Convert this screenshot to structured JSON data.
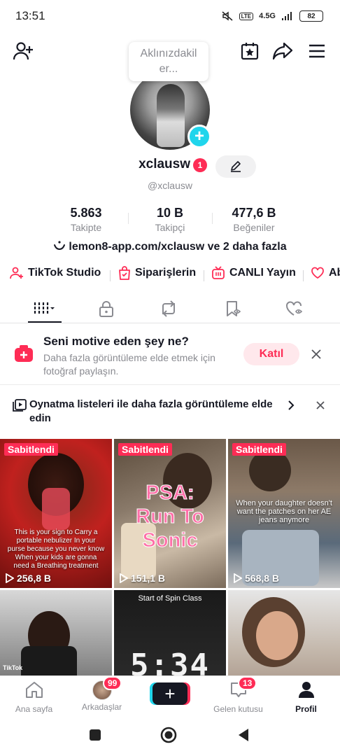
{
  "status_bar": {
    "time": "13:51",
    "network": "4.5G",
    "lte": "LTE",
    "battery": "82"
  },
  "tooltip": {
    "text": "Aklınızdakil er..."
  },
  "profile": {
    "username": "xclausw",
    "notification_count": "1",
    "handle": "@xclausw",
    "bio_link": "lemon8-app.com/xclausw ve 2 daha fazla"
  },
  "stats": [
    {
      "value": "5.863",
      "label": "Takipte"
    },
    {
      "value": "10 B",
      "label": "Takipçi"
    },
    {
      "value": "477,6 B",
      "label": "Beğeniler"
    }
  ],
  "shortcuts": [
    {
      "label": "TikTok Studio",
      "icon": "person-plus-icon"
    },
    {
      "label": "Siparişlerin",
      "icon": "shopping-bag-icon"
    },
    {
      "label": "CANLI Yayın",
      "icon": "live-tv-icon"
    },
    {
      "label": "Ab",
      "icon": "hearts-icon"
    }
  ],
  "tabs": [
    {
      "icon": "grid-icon",
      "active": true
    },
    {
      "icon": "lock-icon"
    },
    {
      "icon": "repost-icon"
    },
    {
      "icon": "saved-icon"
    },
    {
      "icon": "liked-icon"
    }
  ],
  "prompt_motivate": {
    "title": "Seni motive eden şey ne?",
    "subtitle": "Daha fazla görüntüleme elde etmek için fotoğraf paylaşın.",
    "button": "Katıl"
  },
  "prompt_playlist": {
    "text": "Oynatma listeleri ile daha fazla görüntüleme elde edin"
  },
  "videos": [
    {
      "pinned": "Sabitlendi",
      "views": "256,8 B",
      "caption": "This is your sign to Carry a portable nebulizer In your purse because you never know When your kids are gonna need a Breathing treatment"
    },
    {
      "pinned": "Sabitlendi",
      "views": "151,1 B",
      "caption": "PSA: Run To Sonic"
    },
    {
      "pinned": "Sabitlendi",
      "views": "568,8 B",
      "caption": "When your daughter doesn't want the patches on her AE jeans anymore"
    },
    {
      "watermark": "TikTok"
    },
    {
      "caption": "Start of Spin Class",
      "timer": "5:34"
    },
    {}
  ],
  "bottom_nav": [
    {
      "label": "Ana sayfa",
      "icon": "home-icon"
    },
    {
      "label": "Arkadaşlar",
      "icon": "friends-avatar",
      "badge": "99"
    },
    {
      "label": "",
      "icon": "create-icon"
    },
    {
      "label": "Gelen kutusu",
      "icon": "inbox-icon",
      "badge": "13"
    },
    {
      "label": "Profil",
      "icon": "profile-icon",
      "active": true
    }
  ],
  "colors": {
    "accent": "#fe2c55",
    "cyan": "#20d5ec",
    "text": "#161823",
    "muted": "#8a8b91"
  }
}
